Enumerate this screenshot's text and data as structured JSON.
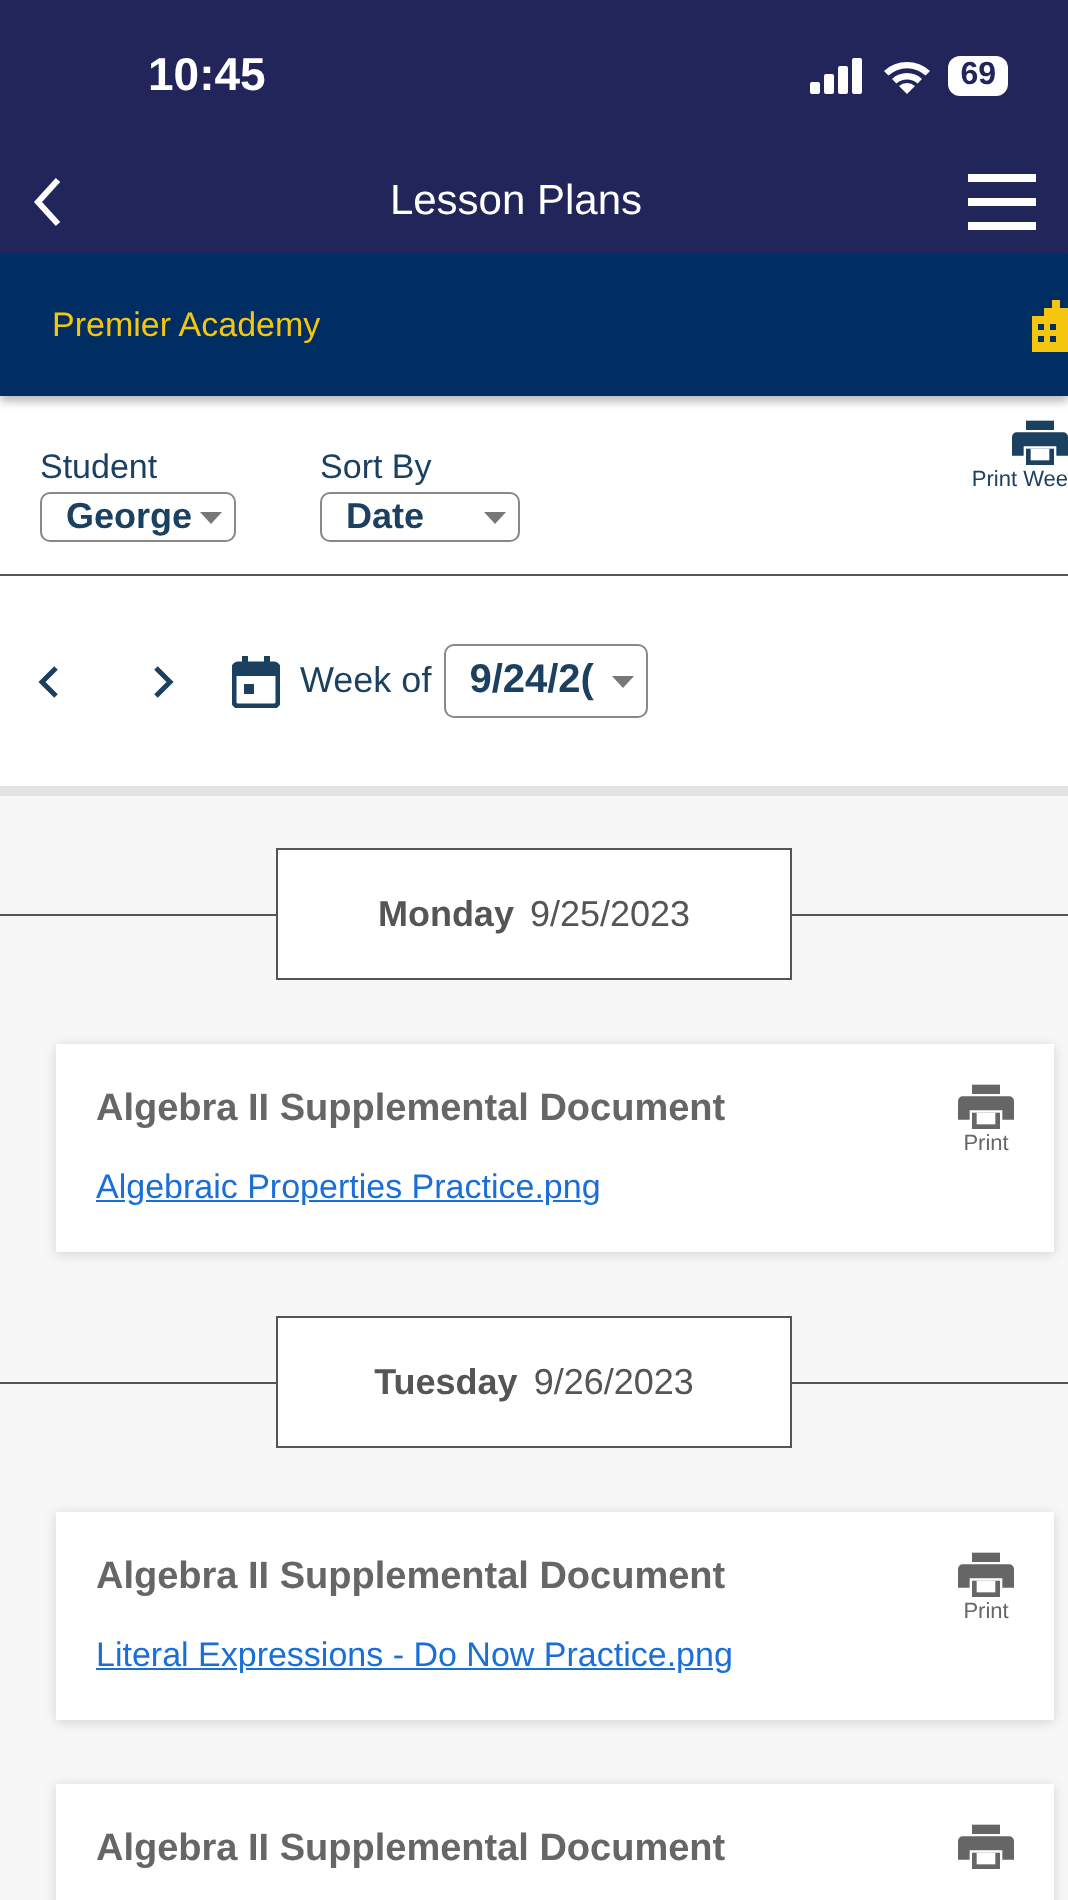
{
  "status_bar": {
    "time": "10:45",
    "battery": "69"
  },
  "nav": {
    "title": "Lesson Plans"
  },
  "school": {
    "name": "Premier Academy"
  },
  "filters": [
    {
      "label": "Student",
      "value": "George"
    },
    {
      "label": "Sort By",
      "value": "Date"
    }
  ],
  "print_week": {
    "label": "Print Wee"
  },
  "week": {
    "label": "Week of",
    "value": "9/24/2("
  },
  "days": [
    {
      "day": "Monday",
      "date": "9/25/2023",
      "items": [
        {
          "title": "Algebra II Supplemental Document",
          "link": "Algebraic Properties Practice.png",
          "print": "Print"
        }
      ]
    },
    {
      "day": "Tuesday",
      "date": "9/26/2023",
      "items": [
        {
          "title": "Algebra II Supplemental Document",
          "link": "Literal Expressions - Do Now Practice.png",
          "print": "Print"
        },
        {
          "title": "Algebra II Supplemental Document"
        }
      ]
    }
  ]
}
